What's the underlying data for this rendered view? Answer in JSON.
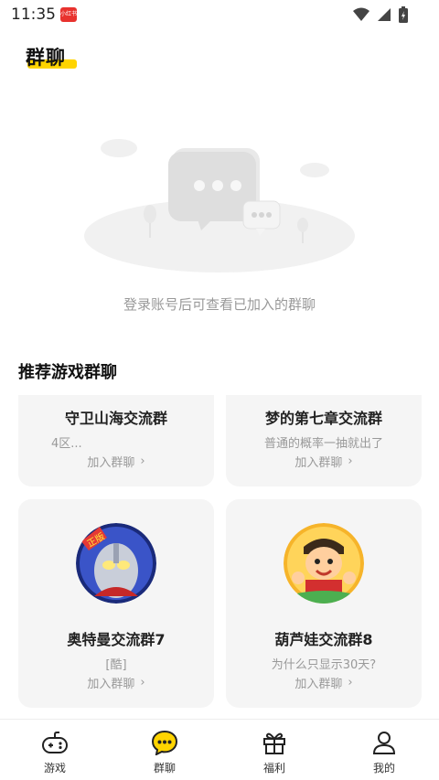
{
  "status_bar": {
    "time": "11:35",
    "app_badge": "小红书"
  },
  "header": {
    "title": "群聊"
  },
  "empty_state": {
    "message": "登录账号后可查看已加入的群聊"
  },
  "recommend": {
    "section_title": "推荐游戏群聊",
    "join_label": "加入群聊",
    "cards": [
      {
        "name": "守卫山海交流群",
        "desc": "4区..."
      },
      {
        "name": "梦的第七章交流群",
        "desc": "普通的概率一抽就出了"
      },
      {
        "name": "奥特曼交流群7",
        "desc": "[酷]"
      },
      {
        "name": "葫芦娃交流群8",
        "desc": "为什么只显示30天?"
      }
    ]
  },
  "bottom_nav": {
    "items": [
      {
        "label": "游戏",
        "icon": "gamepad-icon"
      },
      {
        "label": "群聊",
        "icon": "chat-bubble-icon"
      },
      {
        "label": "福利",
        "icon": "gift-icon"
      },
      {
        "label": "我的",
        "icon": "person-icon"
      }
    ]
  },
  "colors": {
    "accent": "#ffd400",
    "card_bg": "#f5f5f5",
    "muted_text": "#999999"
  }
}
